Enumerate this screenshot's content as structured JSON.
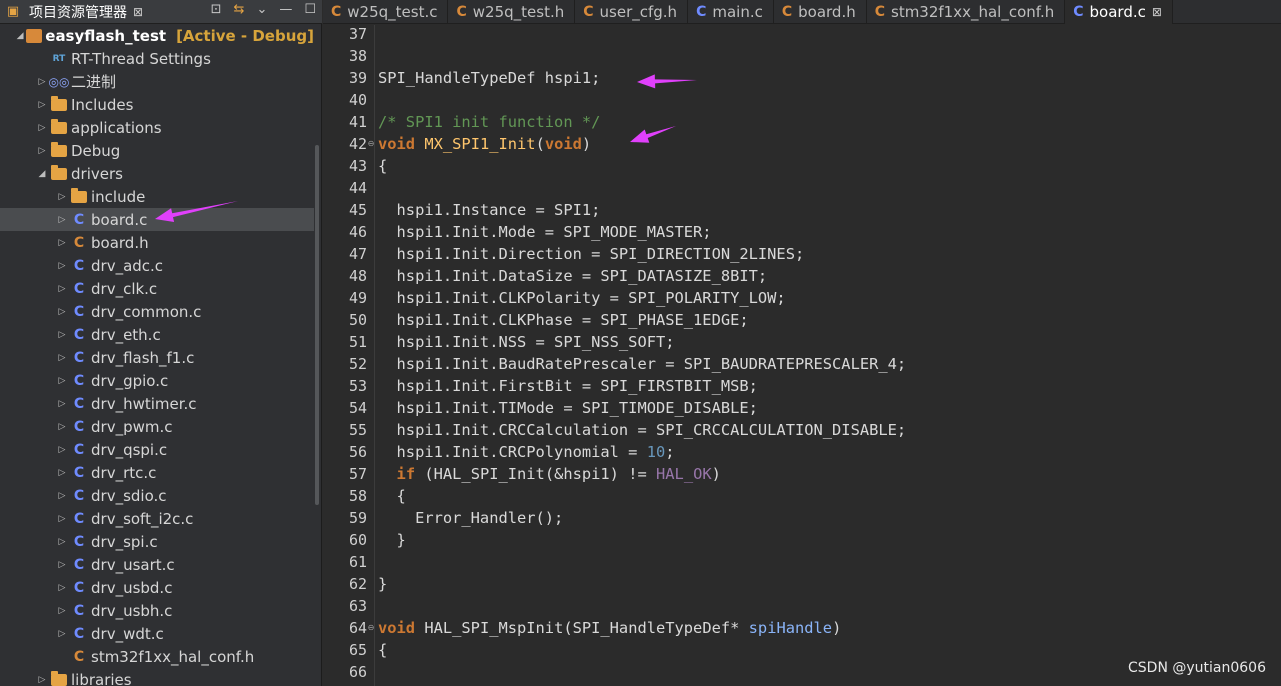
{
  "explorer": {
    "title": "项目资源管理器",
    "close": "⊠",
    "tools": [
      "⊡",
      "⇆",
      "⌄",
      "—",
      "☐"
    ],
    "tree": [
      {
        "label": "easyflash_test",
        "extra": "[Active - Debug]",
        "icon": "project-icon",
        "depth": 0,
        "arrow": "open"
      },
      {
        "label": "RT-Thread Settings",
        "icon": "rt-icon",
        "depth": 1,
        "arrow": "none"
      },
      {
        "label": "二进制",
        "icon": "binary-icon",
        "depth": 1,
        "arrow": "closed"
      },
      {
        "label": "Includes",
        "icon": "folder-icon",
        "depth": 1,
        "arrow": "closed"
      },
      {
        "label": "applications",
        "icon": "folder-icon",
        "depth": 1,
        "arrow": "closed"
      },
      {
        "label": "Debug",
        "icon": "folder-icon",
        "depth": 1,
        "arrow": "closed"
      },
      {
        "label": "drivers",
        "icon": "folder-icon",
        "depth": 1,
        "arrow": "open"
      },
      {
        "label": "include",
        "icon": "folder-icon",
        "depth": 2,
        "arrow": "closed"
      },
      {
        "label": "board.c",
        "icon": "c-source-icon",
        "depth": 2,
        "arrow": "closed",
        "selected": true
      },
      {
        "label": "board.h",
        "icon": "c-header-icon",
        "depth": 2,
        "arrow": "closed"
      },
      {
        "label": "drv_adc.c",
        "icon": "c-source-icon",
        "depth": 2,
        "arrow": "closed"
      },
      {
        "label": "drv_clk.c",
        "icon": "c-source-icon",
        "depth": 2,
        "arrow": "closed"
      },
      {
        "label": "drv_common.c",
        "icon": "c-source-icon",
        "depth": 2,
        "arrow": "closed"
      },
      {
        "label": "drv_eth.c",
        "icon": "c-source-icon",
        "depth": 2,
        "arrow": "closed"
      },
      {
        "label": "drv_flash_f1.c",
        "icon": "c-source-icon",
        "depth": 2,
        "arrow": "closed"
      },
      {
        "label": "drv_gpio.c",
        "icon": "c-source-icon",
        "depth": 2,
        "arrow": "closed"
      },
      {
        "label": "drv_hwtimer.c",
        "icon": "c-source-icon",
        "depth": 2,
        "arrow": "closed"
      },
      {
        "label": "drv_pwm.c",
        "icon": "c-source-icon",
        "depth": 2,
        "arrow": "closed"
      },
      {
        "label": "drv_qspi.c",
        "icon": "c-source-icon",
        "depth": 2,
        "arrow": "closed"
      },
      {
        "label": "drv_rtc.c",
        "icon": "c-source-icon",
        "depth": 2,
        "arrow": "closed"
      },
      {
        "label": "drv_sdio.c",
        "icon": "c-source-icon",
        "depth": 2,
        "arrow": "closed"
      },
      {
        "label": "drv_soft_i2c.c",
        "icon": "c-source-icon",
        "depth": 2,
        "arrow": "closed"
      },
      {
        "label": "drv_spi.c",
        "icon": "c-source-icon",
        "depth": 2,
        "arrow": "closed"
      },
      {
        "label": "drv_usart.c",
        "icon": "c-source-icon",
        "depth": 2,
        "arrow": "closed"
      },
      {
        "label": "drv_usbd.c",
        "icon": "c-source-icon",
        "depth": 2,
        "arrow": "closed"
      },
      {
        "label": "drv_usbh.c",
        "icon": "c-source-icon",
        "depth": 2,
        "arrow": "closed"
      },
      {
        "label": "drv_wdt.c",
        "icon": "c-source-icon",
        "depth": 2,
        "arrow": "closed"
      },
      {
        "label": "stm32f1xx_hal_conf.h",
        "icon": "c-header-icon",
        "depth": 2,
        "arrow": "none"
      },
      {
        "label": "libraries",
        "icon": "folder-icon",
        "depth": 1,
        "arrow": "closed"
      }
    ]
  },
  "tabs": [
    {
      "label": "w25q_test.c",
      "kind": "header-color"
    },
    {
      "label": "w25q_test.h",
      "kind": "header-color"
    },
    {
      "label": "user_cfg.h",
      "kind": "header-color"
    },
    {
      "label": "main.c",
      "kind": "source"
    },
    {
      "label": "board.h",
      "kind": "header-color"
    },
    {
      "label": "stm32f1xx_hal_conf.h",
      "kind": "header-color"
    },
    {
      "label": "board.c",
      "kind": "source",
      "active": true,
      "close": "⊠"
    }
  ],
  "tab_icon_letter": "C",
  "editor": {
    "lines": [
      {
        "n": "37",
        "segs": []
      },
      {
        "n": "38",
        "segs": []
      },
      {
        "n": "39",
        "segs": [
          {
            "t": "SPI_HandleTypeDef hspi1;",
            "c": ""
          }
        ]
      },
      {
        "n": "40",
        "segs": []
      },
      {
        "n": "41",
        "segs": [
          {
            "t": "/* SPI1 init function */",
            "c": "cm"
          }
        ]
      },
      {
        "n": "42",
        "fold": true,
        "segs": [
          {
            "t": "void",
            "c": "kw"
          },
          {
            "t": " ",
            "c": ""
          },
          {
            "t": "MX_SPI1_Init",
            "c": "fn"
          },
          {
            "t": "(",
            "c": ""
          },
          {
            "t": "void",
            "c": "kw"
          },
          {
            "t": ")",
            "c": ""
          }
        ]
      },
      {
        "n": "43",
        "segs": [
          {
            "t": "{",
            "c": ""
          }
        ]
      },
      {
        "n": "44",
        "segs": []
      },
      {
        "n": "45",
        "segs": [
          {
            "t": "  hspi1.Instance = SPI1;",
            "c": ""
          }
        ]
      },
      {
        "n": "46",
        "segs": [
          {
            "t": "  hspi1.Init.Mode = SPI_MODE_MASTER;",
            "c": ""
          }
        ]
      },
      {
        "n": "47",
        "segs": [
          {
            "t": "  hspi1.Init.Direction = SPI_DIRECTION_2LINES;",
            "c": ""
          }
        ]
      },
      {
        "n": "48",
        "segs": [
          {
            "t": "  hspi1.Init.DataSize = SPI_DATASIZE_8BIT;",
            "c": ""
          }
        ]
      },
      {
        "n": "49",
        "segs": [
          {
            "t": "  hspi1.Init.CLKPolarity = SPI_POLARITY_LOW;",
            "c": ""
          }
        ]
      },
      {
        "n": "50",
        "segs": [
          {
            "t": "  hspi1.Init.CLKPhase = SPI_PHASE_1EDGE;",
            "c": ""
          }
        ]
      },
      {
        "n": "51",
        "segs": [
          {
            "t": "  hspi1.Init.NSS = SPI_NSS_SOFT;",
            "c": ""
          }
        ]
      },
      {
        "n": "52",
        "segs": [
          {
            "t": "  hspi1.Init.BaudRatePrescaler = SPI_BAUDRATEPRESCALER_4;",
            "c": ""
          }
        ]
      },
      {
        "n": "53",
        "segs": [
          {
            "t": "  hspi1.Init.FirstBit = SPI_FIRSTBIT_MSB;",
            "c": ""
          }
        ]
      },
      {
        "n": "54",
        "segs": [
          {
            "t": "  hspi1.Init.TIMode = SPI_TIMODE_DISABLE;",
            "c": ""
          }
        ]
      },
      {
        "n": "55",
        "segs": [
          {
            "t": "  hspi1.Init.CRCCalculation = SPI_CRCCALCULATION_DISABLE;",
            "c": ""
          }
        ]
      },
      {
        "n": "56",
        "segs": [
          {
            "t": "  hspi1.Init.CRCPolynomial = ",
            "c": ""
          },
          {
            "t": "10",
            "c": "num"
          },
          {
            "t": ";",
            "c": ""
          }
        ]
      },
      {
        "n": "57",
        "segs": [
          {
            "t": "  ",
            "c": ""
          },
          {
            "t": "if",
            "c": "kw"
          },
          {
            "t": " (HAL_SPI_Init(&hspi1) != ",
            "c": ""
          },
          {
            "t": "HAL_OK",
            "c": "mac"
          },
          {
            "t": ")",
            "c": ""
          }
        ]
      },
      {
        "n": "58",
        "segs": [
          {
            "t": "  {",
            "c": ""
          }
        ]
      },
      {
        "n": "59",
        "segs": [
          {
            "t": "    Error_Handler();",
            "c": ""
          }
        ]
      },
      {
        "n": "60",
        "segs": [
          {
            "t": "  }",
            "c": ""
          }
        ]
      },
      {
        "n": "61",
        "segs": []
      },
      {
        "n": "62",
        "segs": [
          {
            "t": "}",
            "c": ""
          }
        ]
      },
      {
        "n": "63",
        "segs": []
      },
      {
        "n": "64",
        "fold": true,
        "segs": [
          {
            "t": "void",
            "c": "kw"
          },
          {
            "t": " HAL_SPI_MspInit(SPI_HandleTypeDef* ",
            "c": ""
          },
          {
            "t": "spiHandle",
            "c": "param"
          },
          {
            "t": ")",
            "c": ""
          }
        ]
      },
      {
        "n": "65",
        "segs": [
          {
            "t": "{",
            "c": ""
          }
        ]
      },
      {
        "n": "66",
        "segs": []
      }
    ]
  },
  "watermark": "CSDN @yutian0606",
  "colors": {
    "arrow": "#e040fb",
    "accent": "#6f8bff"
  }
}
